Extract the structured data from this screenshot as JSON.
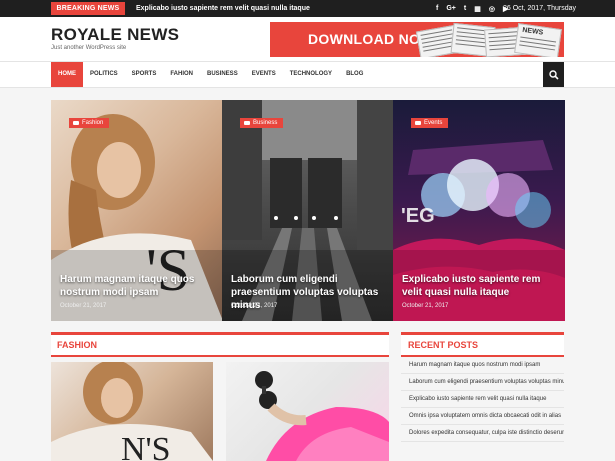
{
  "topbar": {
    "breaking_label": "BREAKING NEWS",
    "ticker": "Explicabo iusto sapiente rem velit quasi nulla itaque",
    "social": [
      "f",
      "G+",
      "t",
      "▦",
      "◎",
      "▶"
    ],
    "date": "26 Oct, 2017, Thursday"
  },
  "header": {
    "logo": "ROYALE NEWS",
    "tagline": "Just another WordPress site",
    "banner": {
      "text": "DOWNLOAD NOW",
      "paper_text": "NEWS"
    }
  },
  "nav": {
    "items": [
      "HOME",
      "POLITICS",
      "SPORTS",
      "FAHION",
      "BUSINESS",
      "EVENTS",
      "TECHNOLOGY",
      "BLOG"
    ]
  },
  "hero": [
    {
      "tag": "Fashion",
      "title": "Harum magnam itaque quos nostrum modi ipsam",
      "date": "October 21, 2017"
    },
    {
      "tag": "Business",
      "title": "Laborum cum eligendi praesentium voluptas voluptas minus",
      "date": "October 21, 2017"
    },
    {
      "tag": "Events",
      "title": "Explicabo iusto sapiente rem velit quasi nulla itaque",
      "date": "October 21, 2017"
    }
  ],
  "fashion": {
    "title": "FASHION"
  },
  "recent": {
    "title": "RECENT POSTS",
    "items": [
      "Harum magnam itaque quos nostrum modi ipsam",
      "Laborum cum eligendi praesentium voluptas voluptas minus",
      "Explicabo iusto sapiente rem velit quasi nulla itaque",
      "Omnis ipsa voluptatem omnis dicta obcaecati odit in alias",
      "Dolores expedita consequatur, culpa iste distinctio deserunt"
    ]
  },
  "colors": {
    "accent": "#e8453c",
    "dark": "#1f1f1f"
  }
}
